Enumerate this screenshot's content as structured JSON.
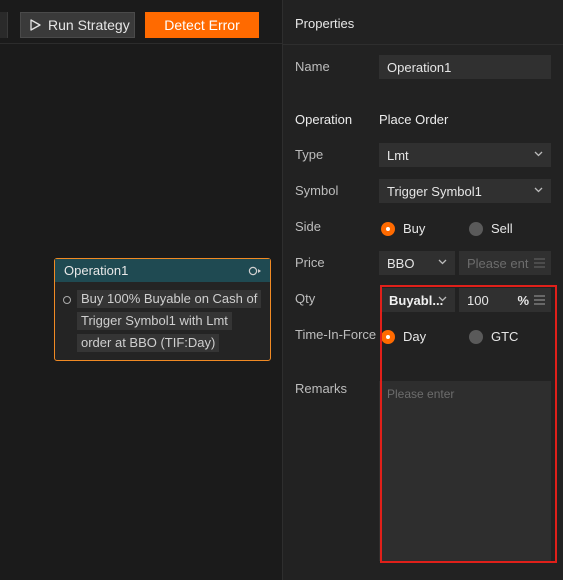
{
  "toolbar": {
    "run_label": "Run Strategy",
    "detect_label": "Detect Error"
  },
  "node": {
    "title": "Operation1",
    "lines": [
      "Buy 100% Buyable on Cash of",
      "Trigger Symbol1 with Lmt",
      "order at BBO  (TIF:Day)"
    ]
  },
  "panel": {
    "title": "Properties",
    "name": {
      "label": "Name",
      "value": "Operation1"
    },
    "operation": {
      "label": "Operation",
      "value": "Place Order"
    },
    "type": {
      "label": "Type",
      "value": "Lmt"
    },
    "symbol": {
      "label": "Symbol",
      "value": "Trigger Symbol1"
    },
    "side": {
      "label": "Side",
      "options": [
        "Buy",
        "Sell"
      ],
      "selected": "Buy"
    },
    "price": {
      "label": "Price",
      "source": "BBO",
      "placeholder": "Please ent"
    },
    "qty": {
      "label": "Qty",
      "mode": "Buyabl...",
      "value": "100",
      "unit": "%"
    },
    "tif": {
      "label": "Time-In-Force",
      "options": [
        "Day",
        "GTC"
      ],
      "selected": "Day"
    },
    "remarks": {
      "label": "Remarks",
      "placeholder": "Please enter"
    }
  },
  "colors": {
    "accent": "#ff6a00",
    "node_header": "#1f4a52",
    "highlight": "#e0201a"
  }
}
